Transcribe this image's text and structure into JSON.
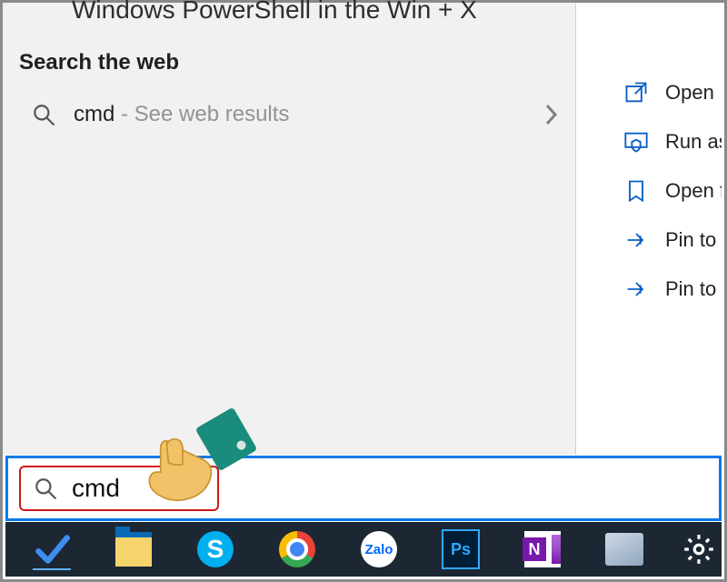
{
  "clipped_header": "Windows PowerShell in the Win + X",
  "section_title": "Search the web",
  "web_result": {
    "term": "cmd",
    "hint": " - See web results"
  },
  "actions": [
    {
      "label": "Open",
      "icon": "open"
    },
    {
      "label": "Run as",
      "icon": "shield"
    },
    {
      "label": "Open f",
      "icon": "folder"
    },
    {
      "label": "Pin to",
      "icon": "pin"
    },
    {
      "label": "Pin to",
      "icon": "pin"
    }
  ],
  "search_input": "cmd",
  "taskbar": {
    "items": [
      "todo",
      "explorer",
      "skype",
      "chrome",
      "zalo",
      "photoshop",
      "onenote",
      "app"
    ],
    "zalo_label": "Zalo",
    "ps_label": "Ps",
    "onenote_label": "N"
  }
}
